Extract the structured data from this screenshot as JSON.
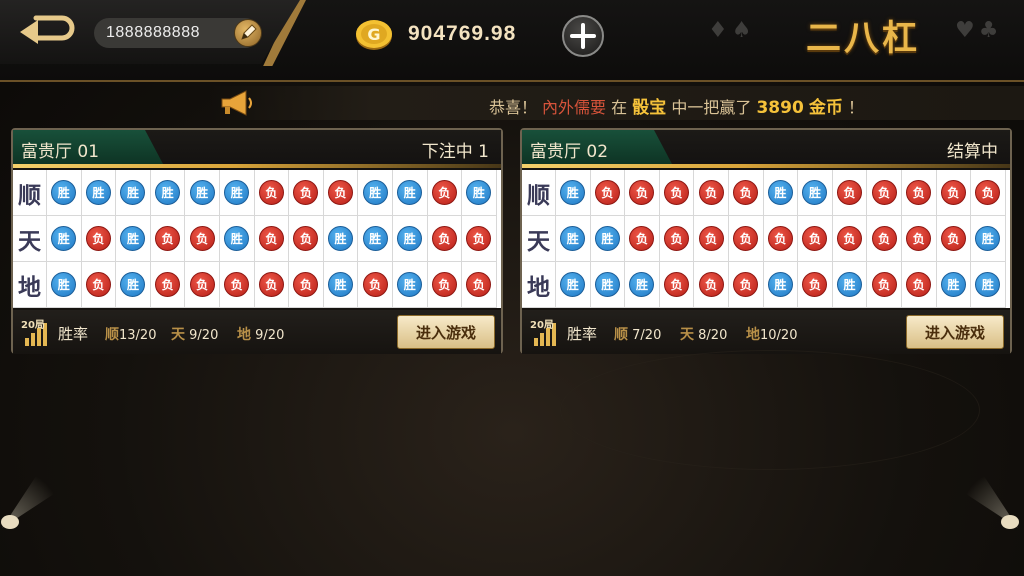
{
  "header": {
    "account_id": "1888888888",
    "coin_balance": "904769.98",
    "game_title": "二八杠",
    "suits_left": "♦♠",
    "suits_right": "♥♣"
  },
  "announcement": {
    "prefix": "恭喜！",
    "player": "內外儒要",
    "in": "在",
    "location": "骰宝",
    "action": "中一把赢了",
    "amount": "3890",
    "currency": "金币",
    "suffix": "！"
  },
  "rooms": [
    {
      "name": "富贵厅 01",
      "status": "下注中 1",
      "rows": [
        {
          "label": "顺",
          "results": [
            "胜",
            "胜",
            "胜",
            "胜",
            "胜",
            "胜",
            "负",
            "负",
            "负",
            "胜",
            "胜",
            "负",
            "胜"
          ]
        },
        {
          "label": "天",
          "results": [
            "胜",
            "负",
            "胜",
            "负",
            "负",
            "胜",
            "负",
            "负",
            "胜",
            "胜",
            "胜",
            "负",
            "负"
          ]
        },
        {
          "label": "地",
          "results": [
            "胜",
            "负",
            "胜",
            "负",
            "负",
            "负",
            "负",
            "负",
            "胜",
            "负",
            "胜",
            "负",
            "负"
          ]
        }
      ],
      "stats_badge": "20局",
      "winrate_label": "胜率",
      "stats": [
        {
          "key": "顺",
          "value": "13/20"
        },
        {
          "key": "天",
          "value": "9/20"
        },
        {
          "key": "地",
          "value": "9/20"
        }
      ],
      "enter_label": "进入游戏"
    },
    {
      "name": "富贵厅 02",
      "status": "结算中",
      "rows": [
        {
          "label": "顺",
          "results": [
            "胜",
            "负",
            "负",
            "负",
            "负",
            "负",
            "胜",
            "胜",
            "负",
            "负",
            "负",
            "负",
            "负"
          ]
        },
        {
          "label": "天",
          "results": [
            "胜",
            "胜",
            "负",
            "负",
            "负",
            "负",
            "负",
            "负",
            "负",
            "负",
            "负",
            "负",
            "胜"
          ]
        },
        {
          "label": "地",
          "results": [
            "胜",
            "胜",
            "胜",
            "负",
            "负",
            "负",
            "胜",
            "负",
            "胜",
            "负",
            "负",
            "胜",
            "胜"
          ]
        }
      ],
      "stats_badge": "20局",
      "winrate_label": "胜率",
      "stats": [
        {
          "key": "顺",
          "value": "7/20"
        },
        {
          "key": "天",
          "value": "8/20"
        },
        {
          "key": "地",
          "value": "10/20"
        }
      ],
      "enter_label": "进入游戏"
    }
  ],
  "colors": {
    "win": "#1f78c4",
    "lose": "#b71f17",
    "title_gold": "#e9b64a",
    "header_green": "#18503a"
  },
  "icons": {
    "back": "back-arrow-icon",
    "edit": "pencil-icon",
    "coin": "gold-coin-icon",
    "add": "plus-icon",
    "announce": "megaphone-icon",
    "stats": "bar-chart-icon"
  }
}
